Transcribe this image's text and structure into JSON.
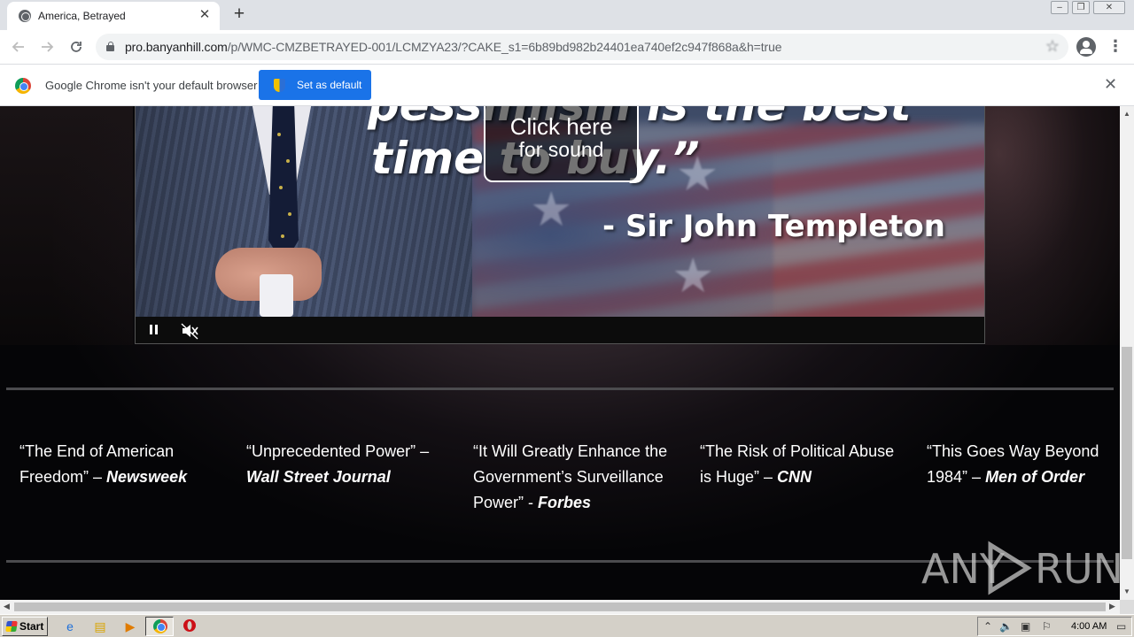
{
  "browser": {
    "tab_title": "America, Betrayed",
    "new_tab_symbol": "+",
    "url_host": "pro.banyanhill.com",
    "url_path": "/p/WMC-CMZBETRAYED-001/LCMZYA23/?CAKE_s1=6b89bd982b24401ea740ef2c947f868a&h=true",
    "infobar_message": "Google Chrome isn't your default browser",
    "set_default_label": "Set as default"
  },
  "video": {
    "quote_line1": "pessimism is the best",
    "quote_line2": "time to buy.”",
    "author": "- Sir John Templeton",
    "sound_prompt_line1": "Click here",
    "sound_prompt_line2": "for sound"
  },
  "press": [
    {
      "quote": "“The End of American Freedom” – ",
      "source": "Newsweek"
    },
    {
      "quote": "“Unprecedented Power” – ",
      "source": "Wall Street Journal"
    },
    {
      "quote": "“It Will Greatly Enhance the Government’s Surveillance Power” - ",
      "source": "Forbes"
    },
    {
      "quote": "“The Risk of Political Abuse is Huge” – ",
      "source": "CNN"
    },
    {
      "quote": "“This Goes Way Beyond 1984” – ",
      "source": "Men of Order"
    }
  ],
  "watermark": {
    "left": "ANY",
    "right": "RUN"
  },
  "taskbar": {
    "start_label": "Start",
    "clock": "4:00 AM"
  },
  "icons": {
    "back": "arrow-left",
    "forward": "arrow-right",
    "reload": "reload",
    "bookmark": "star-outline",
    "menu": "vertical-dots"
  }
}
